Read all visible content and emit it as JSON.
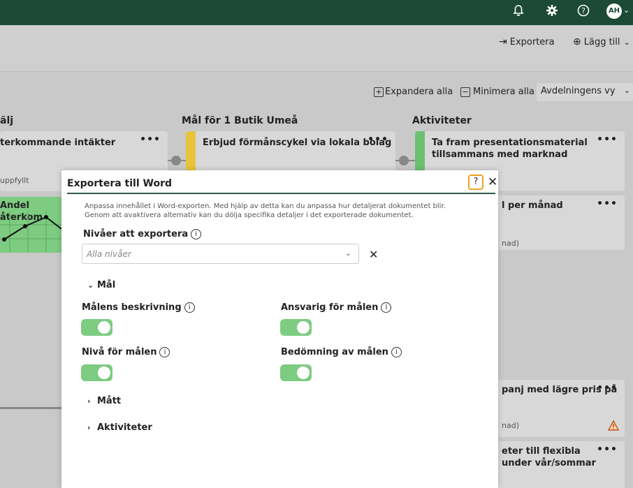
{
  "topbar": {
    "icons": [
      "bell-icon",
      "gear-icon",
      "help-circle-icon"
    ],
    "avatar_initials": "AH"
  },
  "toolbar": {
    "export_label": "Exportera",
    "add_label": "Lägg till"
  },
  "board_controls": {
    "expand_all": "Expandera alla",
    "collapse_all": "Minimera alla",
    "view_select": "Avdelningens vy"
  },
  "columns": {
    "left_title": "älj",
    "middle_title": "Mål för 1 Butik Umeå",
    "right_title": "Aktiviteter"
  },
  "cards": {
    "left_1_title": "terkommande intäkter",
    "left_1_sub": "uppfyllt",
    "left_2_title": "Andel återkom",
    "middle_1_title": "Erbjud förmånscykel via lokala bolag",
    "right_1_title_line1": "Ta fram presentationsmaterial",
    "right_1_title_line2": "tillsammans med marknad",
    "right_2_title": "l per månad",
    "right_2_sub": "nad)",
    "right_3_title": "panj med lägre pris på",
    "right_3_sub": "nad)",
    "right_4_title_line1": "eter till flexibla",
    "right_4_title_line2": "under vår/sommar",
    "dots": "•••"
  },
  "colors": {
    "topbar": "#1c4a37",
    "toggle_on": "#7ecb82",
    "stripe_yellow": "#e8c43a",
    "stripe_green": "#6cc070",
    "highlight": "#f0a020"
  },
  "modal": {
    "title": "Exportera till Word",
    "description_line1": "Anpassa innehållet i Word-exporten. Med hjälp av detta kan du anpassa hur detaljerat dokumentet blir.",
    "description_line2": "Genom att avaktivera alternativ kan du dölja specifika detaljer i det exporterade dokumentet.",
    "levels_label": "Nivåer att exportera",
    "levels_placeholder": "Alla nivåer",
    "section_goals": "Mål",
    "goal_description": "Målens beskrivning",
    "goal_owner": "Ansvarig för målen",
    "goal_level": "Nivå för målen",
    "goal_assessment": "Bedömning av målen",
    "section_measures": "Mått",
    "section_activities": "Aktiviteter",
    "toggles": {
      "goal_description": true,
      "goal_owner": true,
      "goal_level": true,
      "goal_assessment": true
    }
  }
}
